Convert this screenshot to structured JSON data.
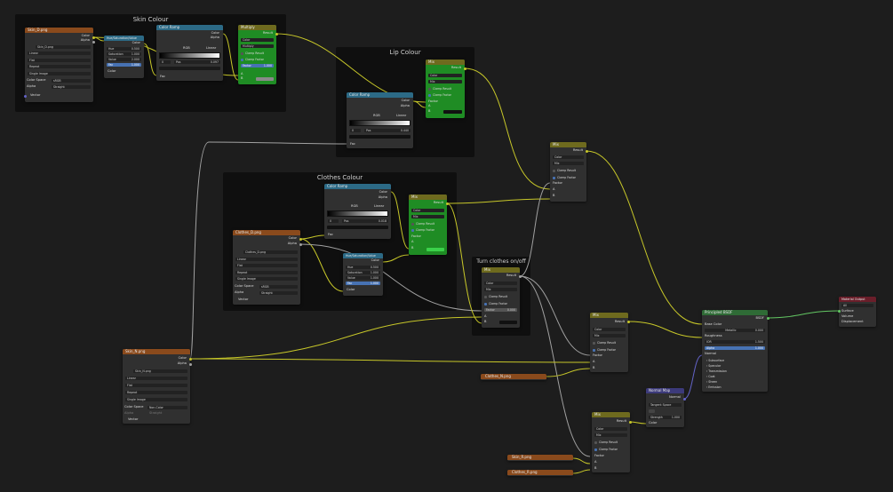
{
  "frames": {
    "skin": "Skin Colour",
    "lip": "Lip Colour",
    "clothes": "Clothes Colour",
    "turn": "Turn clothes on/off"
  },
  "skin_tex": {
    "header": "Skin_D.png",
    "out_color": "Color",
    "out_alpha": "Alpha",
    "image": "Skin_D.png",
    "interpolation": "Linear",
    "projection": "Flat",
    "extension": "Repeat",
    "source": "Single Image",
    "colorspace_label": "Color Space",
    "colorspace": "sRGB",
    "alpha_label": "Alpha",
    "alpha": "Straight",
    "in_vector": "Vector"
  },
  "hsv_skin": {
    "header": "Hue/Saturation/Value",
    "out_color": "Color",
    "hue": "Hue",
    "hue_v": "0.500",
    "sat": "Saturation",
    "sat_v": "1.000",
    "val": "Value",
    "val_v": "2.000",
    "fac": "Fac",
    "fac_v": "1.000",
    "in_color": "Color"
  },
  "ramp_skin": {
    "header": "Color Ramp",
    "out_color": "Color",
    "out_alpha": "Alpha",
    "mode": "RGB",
    "interp": "Linear",
    "stop": "0",
    "pos": "Pos",
    "pos_v": "0.097",
    "in_fac": "Fac"
  },
  "multiply": {
    "header": "Multiply",
    "out_result": "Result",
    "type": "Color",
    "blend": "Multiply",
    "clamp_result": "Clamp Result",
    "clamp_factor": "Clamp Factor",
    "factor": "Factor",
    "factor_v": "1.000",
    "a": "A",
    "b": "B"
  },
  "mix_lip": {
    "header": "Mix",
    "out_result": "Result",
    "type": "Color",
    "blend": "Mix",
    "clamp_result": "Clamp Result",
    "clamp_factor": "Clamp Factor",
    "factor": "Factor",
    "a": "A",
    "b": "B"
  },
  "ramp_lip": {
    "header": "Color Ramp",
    "out_color": "Color",
    "out_alpha": "Alpha",
    "mode": "RGB",
    "interp": "Linear",
    "stop": "0",
    "pos": "Pos",
    "pos_v": "0.440",
    "in_fac": "Fac"
  },
  "mix_right": {
    "header": "Mix",
    "out_result": "Result",
    "type": "Color",
    "blend": "Mix",
    "clamp_result": "Clamp Result",
    "clamp_factor": "Clamp Factor",
    "factor": "Factor",
    "a": "A",
    "b": "B"
  },
  "ramp_clothes": {
    "header": "Color Ramp",
    "out_color": "Color",
    "out_alpha": "Alpha",
    "mode": "RGB",
    "interp": "Linear",
    "stop": "0",
    "pos": "Pos",
    "pos_v": "0.018",
    "in_fac": "Fac"
  },
  "mix_clothes": {
    "header": "Mix",
    "out_result": "Result",
    "type": "Color",
    "blend": "Mix",
    "clamp_result": "Clamp Result",
    "clamp_factor": "Clamp Factor",
    "factor": "Factor",
    "a": "A",
    "b": "B"
  },
  "clothes_tex": {
    "header": "Clothes_D.png",
    "out_color": "Color",
    "out_alpha": "Alpha",
    "image": "Clothes_D.png",
    "interpolation": "Linear",
    "projection": "Flat",
    "extension": "Repeat",
    "source": "Single Image",
    "colorspace_label": "Color Space",
    "colorspace": "sRGB",
    "alpha_label": "Alpha",
    "alpha": "Straight",
    "in_vector": "Vector"
  },
  "hsv_clothes": {
    "header": "Hue/Saturation/Value",
    "out_color": "Color",
    "hue": "Hue",
    "hue_v": "0.500",
    "sat": "Saturation",
    "sat_v": "1.000",
    "val": "Value",
    "val_v": "1.000",
    "fac": "Fac",
    "fac_v": "1.000",
    "in_color": "Color"
  },
  "mix_turn": {
    "header": "Mix",
    "out_result": "Result",
    "type": "Color",
    "blend": "Mix",
    "clamp_result": "Clamp Result",
    "clamp_factor": "Clamp Factor",
    "factor": "Factor",
    "factor_v": "0.000",
    "a": "A",
    "b": "B"
  },
  "skin_n": {
    "header": "Skin_N.png",
    "out_color": "Color",
    "out_alpha": "Alpha",
    "image": "Skin_N.png",
    "interpolation": "Linear",
    "projection": "Flat",
    "extension": "Repeat",
    "source": "Single Image",
    "colorspace_label": "Color Space",
    "colorspace": "Non-Color",
    "alpha_label": "Alpha",
    "alpha": "Straight",
    "in_vector": "Vector"
  },
  "collapsed": {
    "clothes_n": "Clothes_N.png",
    "skin_r": "Skin_R.png",
    "clothes_r": "Clothes_R.png"
  },
  "mix_rough": {
    "header": "Mix",
    "out_result": "Result",
    "type": "Color",
    "blend": "Mix",
    "clamp_result": "Clamp Result",
    "clamp_factor": "Clamp Factor",
    "factor": "Factor",
    "a": "A",
    "b": "B"
  },
  "mix_normal": {
    "header": "Mix",
    "out_result": "Result",
    "type": "Color",
    "blend": "Mix",
    "clamp_result": "Clamp Result",
    "clamp_factor": "Clamp Factor",
    "factor": "Factor",
    "a": "A",
    "b": "B"
  },
  "normal_map": {
    "header": "Normal Map",
    "out_normal": "Normal",
    "space": "Tangent Space",
    "strength": "Strength",
    "strength_v": "1.000",
    "in_color": "Color"
  },
  "bsdf": {
    "header": "Principled BSDF",
    "out_bsdf": "BSDF",
    "base_color": "Base Color",
    "metallic": "Metallic",
    "metallic_v": "0.000",
    "roughness": "Roughness",
    "ior": "IOR",
    "ior_v": "1.500",
    "alpha": "Alpha",
    "alpha_v": "1.000",
    "normal": "Normal",
    "sub": "Subsurface",
    "spec": "Specular",
    "trans": "Transmission",
    "coat": "Coat",
    "sheen": "Sheen",
    "emission": "Emission"
  },
  "output": {
    "header": "Material Output",
    "target": "All",
    "surface": "Surface",
    "volume": "Volume",
    "displacement": "Displacement"
  },
  "colors": {
    "bg": "#1d1d1d",
    "frame": "#0f0f0f",
    "wire_color": "#c7c729",
    "wire_gray": "#a1a1a1",
    "wire_vector": "#6363c7",
    "wire_shader": "#63c763",
    "green_node": "#1f8c24"
  }
}
